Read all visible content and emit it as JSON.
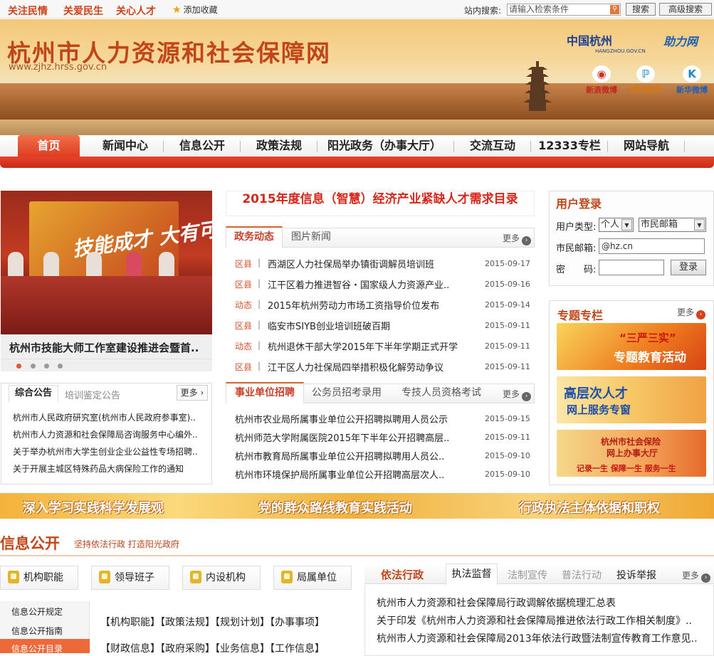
{
  "topbar": {
    "links": [
      "关注民情",
      "关爱民生",
      "关心人才"
    ],
    "favorite": "添加收藏",
    "search_label": "站内搜索:",
    "search_placeholder": "请输入检索条件",
    "search_button": "搜索",
    "advanced_button": "高级搜索"
  },
  "banner": {
    "title": "杭州市人力资源和社会保障网",
    "url": "www.zjhz.hrss.gov.cn",
    "partner_logo_1": "中国杭州",
    "partner_logo_1_sub": "HANGZHOU.GOV.CN",
    "partner_logo_2": "助力网",
    "weibo": [
      "新浪微博",
      "腾讯微博",
      "新华微博"
    ]
  },
  "nav": [
    "首页",
    "新闻中心",
    "信息公开",
    "政策法规",
    "阳光政务（办事大厅）",
    "交流互动",
    "12333专栏",
    "网站导航"
  ],
  "slide": {
    "backdrop_text": "技能成才 大有可为",
    "caption": "杭州市技能大师工作室建设推进会暨首.."
  },
  "notices": {
    "tabs": [
      "综合公告",
      "培训鉴定公告"
    ],
    "more": "更多",
    "items": [
      "杭州市人民政府研究室(杭州市人民政府参事室)..",
      "杭州市人力资源和社会保障局咨询服务中心编外..",
      "关于举办杭州市大学生创业企业公益性专场招聘..",
      "关于开展主城区特殊药品大病保险工作的通知"
    ]
  },
  "headline": "2015年度信息（智慧）经济产业紧缺人才需求目录",
  "news": {
    "tabs": [
      "政务动态",
      "图片新闻"
    ],
    "more": "更多",
    "items": [
      {
        "cat": "区县",
        "title": "西湖区人力社保局举办镇街调解员培训班",
        "date": "2015-09-17"
      },
      {
        "cat": "区县",
        "title": "江干区着力推进智谷・国家级人力资源产业..",
        "date": "2015-09-16"
      },
      {
        "cat": "动态",
        "title": "2015年杭州劳动力市场工资指导价位发布",
        "date": "2015-09-14"
      },
      {
        "cat": "区县",
        "title": "临安市SIYB创业培训班破百期",
        "date": "2015-09-11"
      },
      {
        "cat": "动态",
        "title": "杭州退休干部大学2015年下半年学期正式开学",
        "date": "2015-09-11"
      },
      {
        "cat": "区县",
        "title": "江干区人力社保局四举措积极化解劳动争议",
        "date": "2015-09-11"
      }
    ]
  },
  "recruit": {
    "tabs": [
      "事业单位招聘",
      "公务员招考录用",
      "专技人员资格考试"
    ],
    "more": "更多",
    "items": [
      {
        "title": "杭州市农业局所属事业单位公开招聘拟聘用人员公示",
        "date": "2015-09-15"
      },
      {
        "title": "杭州师范大学附属医院2015年下半年公开招聘高层..",
        "date": "2015-09-11"
      },
      {
        "title": "杭州市教育局所属事业单位公开招聘拟聘用人员公..",
        "date": "2015-09-10"
      },
      {
        "title": "杭州市环境保护局所属事业单位公开招聘高层次人..",
        "date": "2015-09-10"
      }
    ]
  },
  "login": {
    "title": "用户登录",
    "type_label": "用户类型:",
    "type_value": "个人",
    "mailbox_value": "市民邮箱",
    "email_label": "市民邮箱:",
    "email_value": "@hz.cn",
    "password_label": "密　　码:",
    "button": "登录"
  },
  "special": {
    "title": "专题专栏",
    "more": "更多",
    "banners": [
      {
        "line1": "“三严三实”",
        "line2": "专题教育活动"
      },
      {
        "line1": "高层次人才",
        "line2": "网上服务专窗"
      },
      {
        "line1": "杭州市社会保险",
        "line2": "网上办事大厅",
        "line3": "记录一生 保障一生 服务一生"
      }
    ]
  },
  "stripe": [
    "深入学习实践科学发展观",
    "党的群众路线教育实践活动",
    "行政执法主体依据和职权"
  ],
  "info": {
    "title": "信息公开",
    "subtitle": "坚持依法行政 打造阳光政府",
    "buttons": [
      "机构职能",
      "领导班子",
      "内设机构",
      "局属单位"
    ],
    "side": [
      "信息公开规定",
      "信息公开指南",
      "信息公开目录"
    ],
    "cats_row1": "【机构职能】【政策法规】【规划计划】【办事事项】",
    "cats_row2": "【财政信息】【政府采购】【业务信息】【工作信息】"
  },
  "law": {
    "title": "依法行政",
    "tabs": [
      "执法监督",
      "法制宣传",
      "普法行动",
      "投诉举报"
    ],
    "more": "更多",
    "items": [
      "杭州市人力资源和社会保障局行政调解依据梳理汇总表",
      "关于印发《杭州市人力资源和社会保障局推进依法行政工作相关制度》..",
      "杭州市人力资源和社会保障局2013年依法行政暨法制宣传教育工作意见.."
    ]
  }
}
